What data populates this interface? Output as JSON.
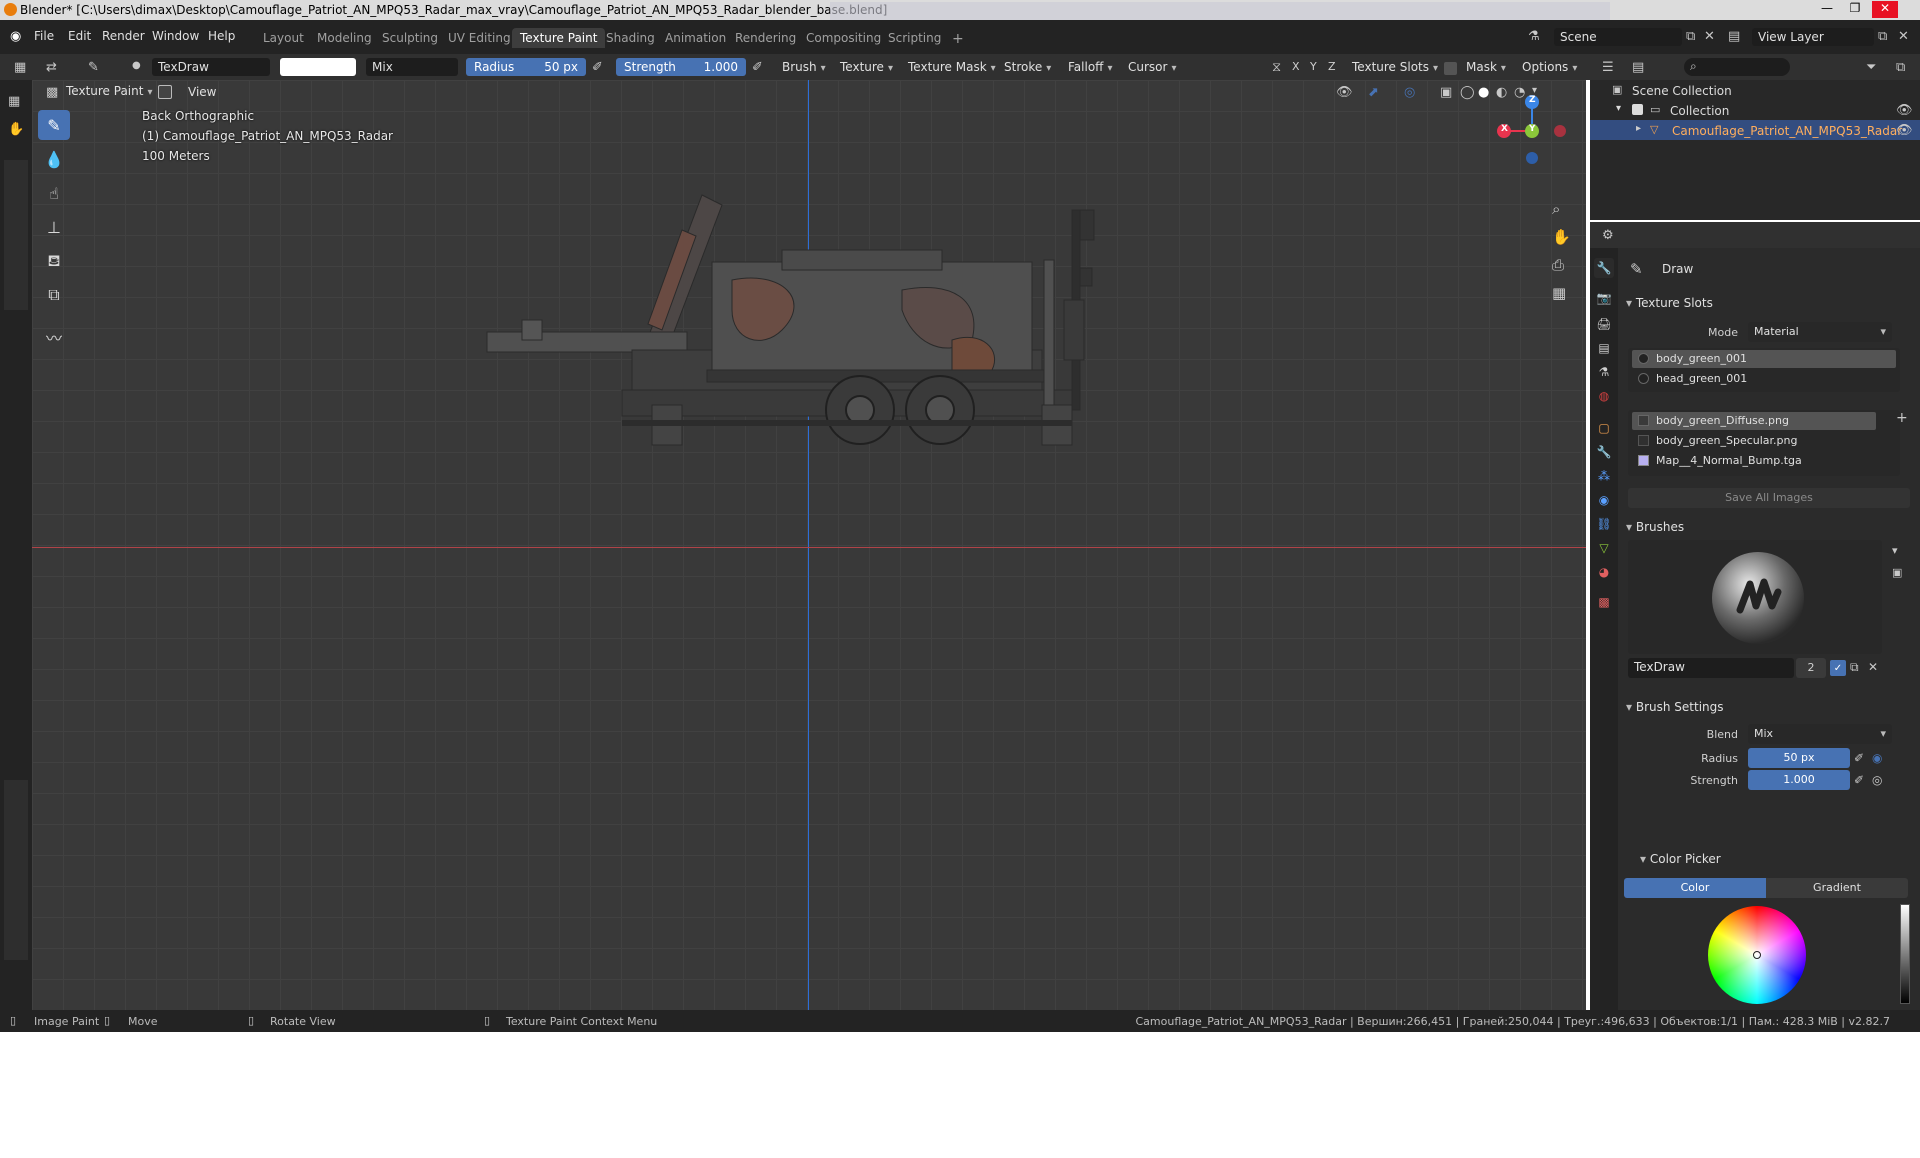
{
  "window": {
    "title": "Blender* [C:\\Users\\dimax\\Desktop\\Camouflage_Patriot_AN_MPQ53_Radar_max_vray\\Camouflage_Patriot_AN_MPQ53_Radar_blender_base.blend]"
  },
  "menu": [
    "File",
    "Edit",
    "Render",
    "Window",
    "Help"
  ],
  "workspaces": [
    "Layout",
    "Modeling",
    "Sculpting",
    "UV Editing",
    "Texture Paint",
    "Shading",
    "Animation",
    "Rendering",
    "Compositing",
    "Scripting"
  ],
  "active_workspace": "Texture Paint",
  "scene": {
    "name": "Scene",
    "view_layer": "View Layer"
  },
  "toolheader": {
    "brush_name": "TexDraw",
    "blend": "Mix",
    "radius_label": "Radius",
    "radius_value": "50 px",
    "strength_label": "Strength",
    "strength_value": "1.000",
    "dropdowns": [
      "Brush",
      "Texture",
      "Texture Mask",
      "Stroke",
      "Falloff",
      "Cursor"
    ],
    "axes": [
      "X",
      "Y",
      "Z"
    ],
    "texture_slots": "Texture Slots",
    "mask": "Mask",
    "options": "Options"
  },
  "viewport": {
    "mode": "Texture Paint",
    "view_menu": "View",
    "view_name": "Back Orthographic",
    "object_label": "(1) Camouflage_Patriot_AN_MPQ53_Radar",
    "scale": "100 Meters",
    "gizmo": {
      "x": "X",
      "y": "Y",
      "z": "Z"
    }
  },
  "outliner": {
    "scene_collection": "Scene Collection",
    "collection": "Collection",
    "object": "Camouflage_Patriot_AN_MPQ53_Radar"
  },
  "properties": {
    "tool_name": "Draw",
    "texture_slots": {
      "title": "Texture Slots",
      "mode_label": "Mode",
      "mode_value": "Material",
      "materials": [
        "body_green_001",
        "head_green_001"
      ],
      "images": [
        "body_green_Diffuse.png",
        "body_green_Specular.png",
        "Map__4_Normal_Bump.tga"
      ],
      "save_all": "Save All Images"
    },
    "brushes": {
      "title": "Brushes",
      "name": "TexDraw",
      "users": "2"
    },
    "brush_settings": {
      "title": "Brush Settings",
      "blend_label": "Blend",
      "blend_value": "Mix",
      "radius_label": "Radius",
      "radius_value": "50 px",
      "strength_label": "Strength",
      "strength_value": "1.000"
    },
    "color_picker": {
      "title": "Color Picker",
      "tab_color": "Color",
      "tab_gradient": "Gradient"
    }
  },
  "statusbar": {
    "image_paint": "Image Paint",
    "move": "Move",
    "rotate": "Rotate View",
    "context": "Texture Paint Context Menu",
    "stats": "Camouflage_Patriot_AN_MPQ53_Radar | Вершин:266,451 | Граней:250,044 | Треуг.:496,633 | Объектов:1/1 | Пам.: 428.3 MiB | v2.82.7"
  },
  "colors": {
    "accent": "#4772b3",
    "selection": "#334d80",
    "object_orange": "#ffae5d",
    "axis_x": "#e8344e",
    "axis_y": "#8bc73a",
    "axis_z": "#3a86e8"
  }
}
